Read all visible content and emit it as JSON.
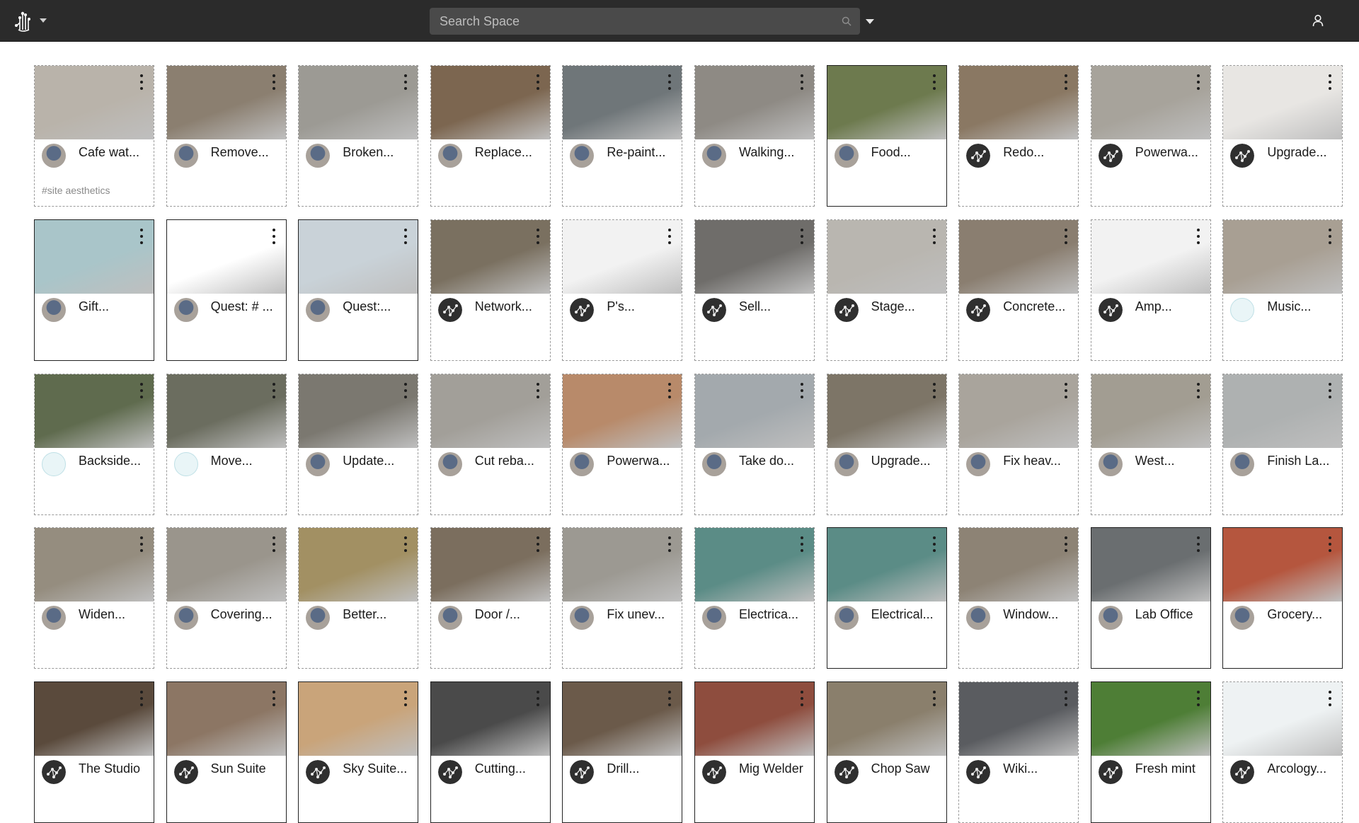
{
  "header": {
    "search_placeholder": "Search Space",
    "logo_icon": "node-hand-logo-icon",
    "user_icon": "user-icon",
    "search_icon": "search-icon"
  },
  "colors": {
    "topbar": "#2b2b2b",
    "search_bg": "#4a4a4a",
    "card_border": "#9a9a9a"
  },
  "cards": [
    {
      "title": "Cafe wat...",
      "tag": "#site aesthetics",
      "avatar": "photo",
      "border": "dashed",
      "thumb": "#b9b3aa"
    },
    {
      "title": "Remove...",
      "avatar": "photo",
      "border": "dashed",
      "thumb": "#8b7f70"
    },
    {
      "title": "Broken...",
      "avatar": "photo",
      "border": "dashed",
      "thumb": "#9c9a94"
    },
    {
      "title": "Replace...",
      "avatar": "photo",
      "border": "dashed",
      "thumb": "#7c6650"
    },
    {
      "title": "Re-paint...",
      "avatar": "photo",
      "border": "dashed",
      "thumb": "#6f7679"
    },
    {
      "title": "Walking...",
      "avatar": "photo",
      "border": "dashed",
      "thumb": "#8e8a84"
    },
    {
      "title": "Food...",
      "avatar": "photo",
      "border": "solid",
      "thumb": "#6d7a4e"
    },
    {
      "title": "Redo...",
      "avatar": "network",
      "border": "dashed",
      "thumb": "#8a7863"
    },
    {
      "title": "Powerwa...",
      "avatar": "network",
      "border": "dashed",
      "thumb": "#a7a39b"
    },
    {
      "title": "Upgrade...",
      "avatar": "network",
      "border": "dashed",
      "thumb": "#e8e6e3"
    },
    {
      "title": "Gift...",
      "avatar": "photo",
      "border": "solid",
      "thumb": "#a9c5c9"
    },
    {
      "title": "Quest: # ...",
      "avatar": "photo",
      "border": "solid",
      "thumb": "#ffffff"
    },
    {
      "title": "Quest:...",
      "avatar": "photo",
      "border": "solid",
      "thumb": "#c9d2d8"
    },
    {
      "title": "Network...",
      "avatar": "network",
      "border": "dashed",
      "thumb": "#7a7060"
    },
    {
      "title": "P's...",
      "avatar": "network",
      "border": "dashed",
      "thumb": "#f2f2f2"
    },
    {
      "title": "Sell...",
      "avatar": "network",
      "border": "dashed",
      "thumb": "#6f6d6a"
    },
    {
      "title": "Stage...",
      "avatar": "network",
      "border": "dashed",
      "thumb": "#b9b6b0"
    },
    {
      "title": "Concrete...",
      "avatar": "network",
      "border": "dashed",
      "thumb": "#8a7e70"
    },
    {
      "title": "Amp...",
      "avatar": "network",
      "border": "dashed",
      "thumb": "#f2f2f2"
    },
    {
      "title": "Music...",
      "avatar": "logo",
      "border": "dashed",
      "thumb": "#a89f93"
    },
    {
      "title": "Backside...",
      "avatar": "logo",
      "border": "dashed",
      "thumb": "#5f6b4e"
    },
    {
      "title": "Move...",
      "avatar": "logo",
      "border": "dashed",
      "thumb": "#6b6d5f"
    },
    {
      "title": "Update...",
      "avatar": "photo",
      "border": "dashed",
      "thumb": "#7b7870"
    },
    {
      "title": "Cut reba...",
      "avatar": "photo",
      "border": "dashed",
      "thumb": "#a29f99"
    },
    {
      "title": "Powerwa...",
      "avatar": "photo",
      "border": "dashed",
      "thumb": "#b88a6a"
    },
    {
      "title": "Take do...",
      "avatar": "photo",
      "border": "dashed",
      "thumb": "#a3a9ad"
    },
    {
      "title": "Upgrade...",
      "avatar": "photo",
      "border": "dashed",
      "thumb": "#7d7567"
    },
    {
      "title": "Fix heav...",
      "avatar": "photo",
      "border": "dashed",
      "thumb": "#a9a49c"
    },
    {
      "title": "West...",
      "avatar": "photo",
      "border": "dashed",
      "thumb": "#a29d92"
    },
    {
      "title": "Finish La...",
      "avatar": "photo",
      "border": "dashed",
      "thumb": "#aeb1b1"
    },
    {
      "title": "Widen...",
      "avatar": "photo",
      "border": "dashed",
      "thumb": "#958d7f"
    },
    {
      "title": "Covering...",
      "avatar": "photo",
      "border": "dashed",
      "thumb": "#9a958c"
    },
    {
      "title": "Better...",
      "avatar": "photo",
      "border": "dashed",
      "thumb": "#a29063"
    },
    {
      "title": "Door /...",
      "avatar": "photo",
      "border": "dashed",
      "thumb": "#7b6e5e"
    },
    {
      "title": "Fix unev...",
      "avatar": "photo",
      "border": "dashed",
      "thumb": "#9c9992"
    },
    {
      "title": "Electrica...",
      "avatar": "photo",
      "border": "dashed",
      "thumb": "#5b8c86"
    },
    {
      "title": "Electrical...",
      "avatar": "photo",
      "border": "solid",
      "thumb": "#5b8c86"
    },
    {
      "title": "Window...",
      "avatar": "photo",
      "border": "dashed",
      "thumb": "#8d8375"
    },
    {
      "title": "Lab Office",
      "avatar": "photo",
      "border": "solid",
      "thumb": "#6a6e70"
    },
    {
      "title": "Grocery...",
      "avatar": "photo",
      "border": "solid",
      "thumb": "#b5563e"
    },
    {
      "title": "The Studio",
      "avatar": "network",
      "border": "solid",
      "thumb": "#5a4a3c"
    },
    {
      "title": "Sun Suite",
      "avatar": "network",
      "border": "solid",
      "thumb": "#8c7664"
    },
    {
      "title": "Sky Suite...",
      "avatar": "network",
      "border": "solid",
      "thumb": "#c9a47a"
    },
    {
      "title": "Cutting...",
      "avatar": "network",
      "border": "solid",
      "thumb": "#4a4a4a"
    },
    {
      "title": "Drill...",
      "avatar": "network",
      "border": "solid",
      "thumb": "#6b5a4a"
    },
    {
      "title": "Mig Welder",
      "avatar": "network",
      "border": "solid",
      "thumb": "#8e4d3e"
    },
    {
      "title": "Chop Saw",
      "avatar": "network",
      "border": "solid",
      "thumb": "#8a7f6c"
    },
    {
      "title": "Wiki...",
      "avatar": "network",
      "border": "dashed",
      "thumb": "#5a5c60"
    },
    {
      "title": "Fresh mint",
      "avatar": "network",
      "border": "solid",
      "thumb": "#4e7e36"
    },
    {
      "title": "Arcology...",
      "avatar": "network",
      "border": "dashed",
      "thumb": "#eef2f3"
    }
  ]
}
